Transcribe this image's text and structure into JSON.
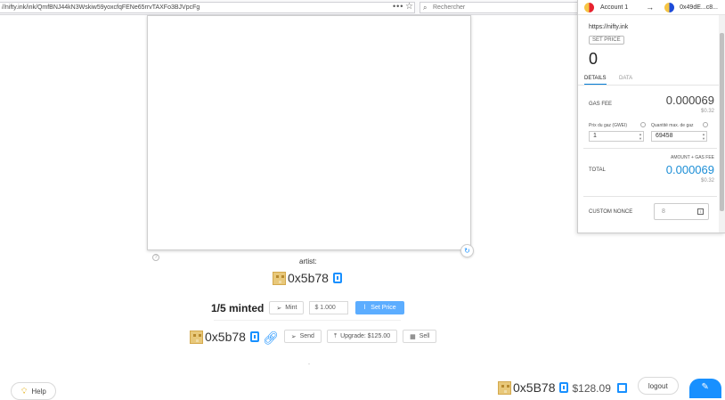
{
  "browser": {
    "url": "//nifty.ink/ink/QmfBNJ44kN3Wskiw59yoxcfqFENe65rrvTAXFo3BJVpcFg",
    "more_label": "•••",
    "star_label": "☆",
    "search_placeholder": "Rechercher"
  },
  "artwork": {
    "help_glyph": "?",
    "redo_glyph": "↻"
  },
  "artist": {
    "label": "artist:",
    "address": "0x5b78"
  },
  "mint": {
    "status": "1/5 minted",
    "mint_label": "Mint",
    "price_value": "$ 1.000",
    "set_price_label": "Set Price"
  },
  "owner": {
    "address": "0x5b78",
    "send_label": "Send",
    "upgrade_label": "Upgrade: $125.00",
    "sell_label": "Sell"
  },
  "footer": {
    "help_label": "Help",
    "account_address": "0x5B78",
    "balance": "$128.09",
    "logout_label": "logout"
  },
  "metamask": {
    "account_name": "Account 1",
    "target_account": "0x49dE...c8...",
    "origin": "https://nifty.ink",
    "method": "SET PRICE",
    "amount": "0",
    "tabs": [
      "DETAILS",
      "DATA"
    ],
    "gas_fee_label": "GAS FEE",
    "gas_fee_eth": "0.000069",
    "gas_fee_fiat": "$0.32",
    "gas_price_label": "Prix du gaz (GWEI)",
    "gas_limit_label": "Quantité max. de gaz",
    "gas_price_value": "1",
    "gas_limit_value": "69458",
    "amount_plus_gas_label": "AMOUNT + GAS FEE",
    "total_label": "TOTAL",
    "total_eth": "0.000069",
    "total_fiat": "$0.32",
    "custom_nonce_label": "CUSTOM NONCE",
    "nonce_value": "8"
  },
  "colors": {
    "accent": "#1890ff",
    "set_price_button": "#5cadff",
    "metamask_blue": "#1c8ed6"
  }
}
